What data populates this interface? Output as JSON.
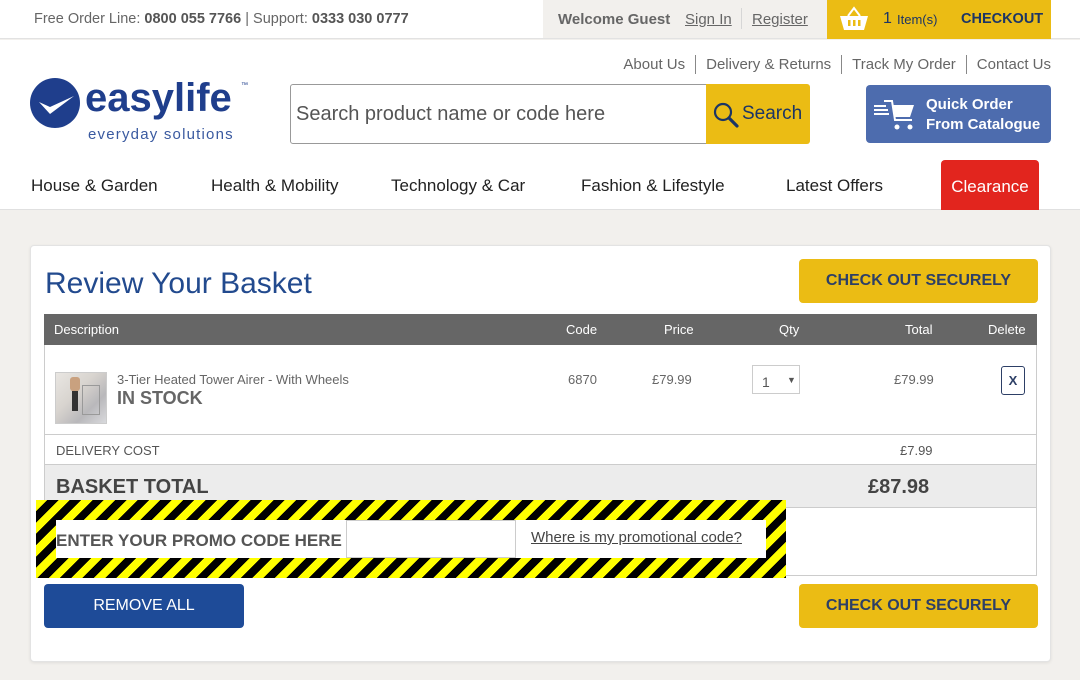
{
  "topbar": {
    "order_line_label": "Free Order Line:",
    "order_line_number": "0800 055 7766",
    "separator": "|",
    "support_label": "Support:",
    "support_number": "0333 030 0777",
    "welcome": "Welcome Guest",
    "sign_in": "Sign In",
    "register": "Register",
    "basket_count": "1",
    "basket_items_label": "Item(s)",
    "checkout": "CHECKOUT"
  },
  "header": {
    "links": [
      "About Us",
      "Delivery & Returns",
      "Track My Order",
      "Contact Us"
    ],
    "logo_word": "easylife",
    "logo_tm": "™",
    "logo_tagline": "everyday solutions",
    "search_placeholder": "Search product name or code here",
    "search_button": "Search",
    "quick_order_line1": "Quick Order",
    "quick_order_line2": "From Catalogue"
  },
  "nav": {
    "items": [
      "House & Garden",
      "Health & Mobility",
      "Technology & Car",
      "Fashion & Lifestyle",
      "Latest Offers"
    ],
    "clearance": "Clearance"
  },
  "basket": {
    "title": "Review Your Basket",
    "checkout_button": "CHECK OUT SECURELY",
    "columns": [
      "Description",
      "Code",
      "Price",
      "Qty",
      "Total",
      "Delete"
    ],
    "items": [
      {
        "name": "3-Tier Heated Tower Airer - With Wheels",
        "stock": "IN STOCK",
        "code": "6870",
        "price": "£79.99",
        "qty": "1",
        "total": "£79.99",
        "delete": "X"
      }
    ],
    "delivery_label": "DELIVERY COST",
    "delivery_value": "£7.99",
    "total_label": "BASKET TOTAL",
    "total_value": "£87.98",
    "promo_label": "ENTER YOUR PROMO CODE HERE",
    "promo_value": "",
    "promo_help": "Where is my promotional code?",
    "remove_all": "REMOVE ALL"
  },
  "colors": {
    "brand_blue": "#1f3e8c",
    "accent_yellow": "#ebbc14",
    "clearance_red": "#e2251e",
    "quick_order_blue": "#4d6cae",
    "remove_blue": "#1e4b98"
  }
}
